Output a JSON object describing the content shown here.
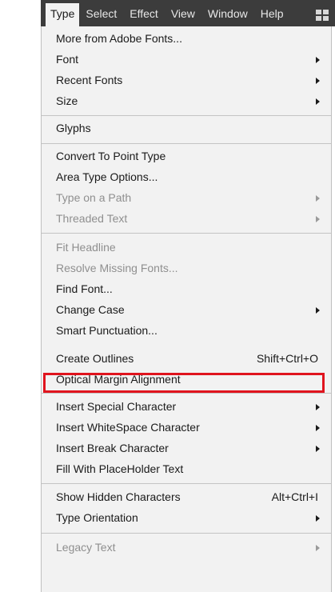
{
  "menubar": {
    "items": [
      "Type",
      "Select",
      "Effect",
      "View",
      "Window",
      "Help"
    ]
  },
  "menu": {
    "items": [
      {
        "label": "More from Adobe Fonts...",
        "shortcut": "",
        "submenu": false,
        "disabled": false
      },
      {
        "label": "Font",
        "shortcut": "",
        "submenu": true,
        "disabled": false
      },
      {
        "label": "Recent Fonts",
        "shortcut": "",
        "submenu": true,
        "disabled": false
      },
      {
        "label": "Size",
        "shortcut": "",
        "submenu": true,
        "disabled": false
      },
      {
        "label": "Glyphs",
        "shortcut": "",
        "submenu": false,
        "disabled": false
      },
      {
        "label": "Convert To Point Type",
        "shortcut": "",
        "submenu": false,
        "disabled": false
      },
      {
        "label": "Area Type Options...",
        "shortcut": "",
        "submenu": false,
        "disabled": false
      },
      {
        "label": "Type on a Path",
        "shortcut": "",
        "submenu": true,
        "disabled": true
      },
      {
        "label": "Threaded Text",
        "shortcut": "",
        "submenu": true,
        "disabled": true
      },
      {
        "label": "Fit Headline",
        "shortcut": "",
        "submenu": false,
        "disabled": true
      },
      {
        "label": "Resolve Missing Fonts...",
        "shortcut": "",
        "submenu": false,
        "disabled": true
      },
      {
        "label": "Find Font...",
        "shortcut": "",
        "submenu": false,
        "disabled": false
      },
      {
        "label": "Change Case",
        "shortcut": "",
        "submenu": true,
        "disabled": false
      },
      {
        "label": "Smart Punctuation...",
        "shortcut": "",
        "submenu": false,
        "disabled": false
      },
      {
        "label": "Create Outlines",
        "shortcut": "Shift+Ctrl+O",
        "submenu": false,
        "disabled": false,
        "highlighted": true
      },
      {
        "label": "Optical Margin Alignment",
        "shortcut": "",
        "submenu": false,
        "disabled": false
      },
      {
        "label": "Insert Special Character",
        "shortcut": "",
        "submenu": true,
        "disabled": false
      },
      {
        "label": "Insert WhiteSpace Character",
        "shortcut": "",
        "submenu": true,
        "disabled": false
      },
      {
        "label": "Insert Break Character",
        "shortcut": "",
        "submenu": true,
        "disabled": false
      },
      {
        "label": "Fill With PlaceHolder Text",
        "shortcut": "",
        "submenu": false,
        "disabled": false
      },
      {
        "label": "Show Hidden Characters",
        "shortcut": "Alt+Ctrl+I",
        "submenu": false,
        "disabled": false
      },
      {
        "label": "Type Orientation",
        "shortcut": "",
        "submenu": true,
        "disabled": false
      },
      {
        "label": "Legacy Text",
        "shortcut": "",
        "submenu": true,
        "disabled": true
      }
    ]
  },
  "colors": {
    "menubar_bg": "#3c3c3c",
    "menu_bg": "#f2f2f2",
    "highlight_border": "#e0141e",
    "disabled_text": "#8f8f8f"
  }
}
